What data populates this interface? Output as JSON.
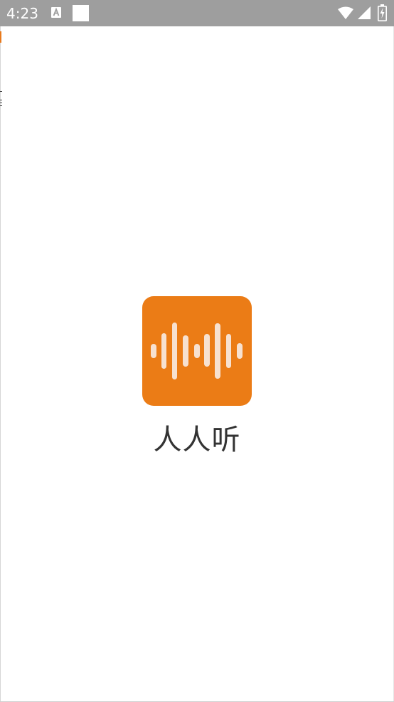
{
  "status_bar": {
    "time": "4:23",
    "background_color": "#9e9e9e",
    "icons": [
      "keyboard-a-icon",
      "notification-square-icon",
      "wifi-icon",
      "cellular-signal-icon",
      "battery-charging-icon"
    ]
  },
  "splash": {
    "app_name": "人人听",
    "logo_icon": "sound-wave-icon",
    "logo_color": "#eb7c16",
    "text_color": "#333333"
  }
}
